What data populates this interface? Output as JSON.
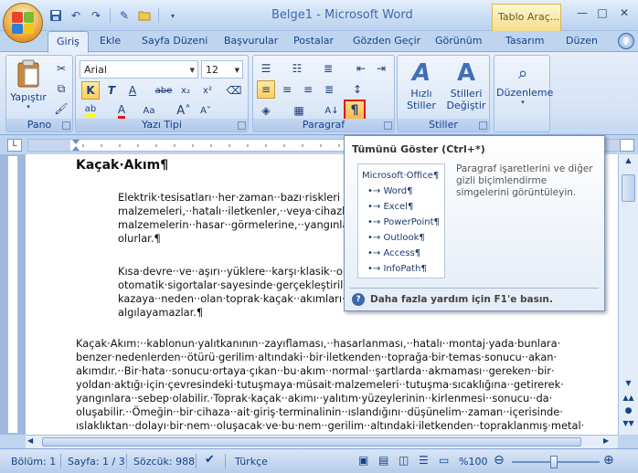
{
  "window": {
    "title": "Belge1 - Microsoft Word",
    "context_tab": "Tablo Araç...",
    "minimize": "—",
    "maximize": "□",
    "close": "✕"
  },
  "tabs": [
    "Giriş",
    "Ekle",
    "Sayfa Düzeni",
    "Başvurular",
    "Postalar",
    "Gözden Geçir",
    "Görünüm",
    "Tasarım",
    "Düzen"
  ],
  "help_button": "?",
  "ribbon": {
    "pano": {
      "label": "Pano",
      "paste": "Yapıştır"
    },
    "yazi_tipi": {
      "label": "Yazı Tipi",
      "font_name": "Arial",
      "font_size": "12"
    },
    "paragraf": {
      "label": "Paragraf"
    },
    "stiller": {
      "label": "Stiller",
      "quick_styles": "Hızlı Stiller",
      "change_styles": "Stilleri Değiştir"
    },
    "duzenleme": {
      "label": "Düzenleme"
    }
  },
  "tooltip": {
    "title": "Tümünü Göster (Ctrl+*)",
    "preview": [
      "Microsoft·Office¶",
      "•→ Word¶",
      "•→ Excel¶",
      "•→ PowerPoint¶",
      "•→ Outlook¶",
      "•→ Access¶",
      "•→ InfoPath¶"
    ],
    "description": "Paragraf işaretlerini ve diğer gizli biçimlendirme simgelerini görüntüleyin.",
    "help": "Daha fazla yardım için F1'e basın."
  },
  "document": {
    "title": "Kaçak·Akım¶",
    "para1": [
      "Elektrik·tesisatları··her·zaman··bazı·riskleri",
      "malzemeleri,··hatalı··iletkenler,··veya·cihazla",
      "malzemelerin··hasar··görmelerine,··yangınla",
      "olurlar.¶"
    ],
    "para2": [
      "Kısa·devre··ve··aşırı··yüklere··karşı·klasik··ola",
      "otomatik·sigortalar·sayesinde·gerçekleştiril",
      "kazaya··neden··olan·toprak·kaçak··akımları·",
      "algılayamazlar.¶"
    ],
    "para3": [
      "Kaçak·Akım:··kablonun·yalıtkanının··zayıflaması,··hasarlanması,··hatalı··montaj·yada·bunlara·",
      "benzer·nedenlerden··ötürü·gerilim·altındaki··bir·iletkenden··toprağa·bir·temas·sonucu··akan·",
      "akımdır.··Bir·hata··sonucu·ortaya·çıkan··bu·akım··normal··şartlarda··akmaması··gereken··bir·",
      "yoldan·aktığı·için·çevresindeki·tutuşmaya·müsait·malzemeleri··tutuşma·sıcaklığına··getirerek·",
      "yangınlara··sebep·olabilir.·Toprak·kaçak··akımı··yalıtım·yüzeylerinin··kirlenmesi··sonucu··da·",
      "oluşabilir.··Ömeğin··bir·cihaza··ait·giriş·terminalinin··ıslandığını··düşünelim··zaman··içerisinde·",
      "ıslaklıktan··dolayı·bir·nem··oluşacak·ve·bu·nem··gerilim··altındaki·iletkenden··topraklanmış·metal·"
    ]
  },
  "status": {
    "section": "Bölüm: 1",
    "page": "Sayfa: 1 / 3",
    "words": "Sözcük: 988",
    "language": "Türkçe",
    "zoom": "%100"
  }
}
